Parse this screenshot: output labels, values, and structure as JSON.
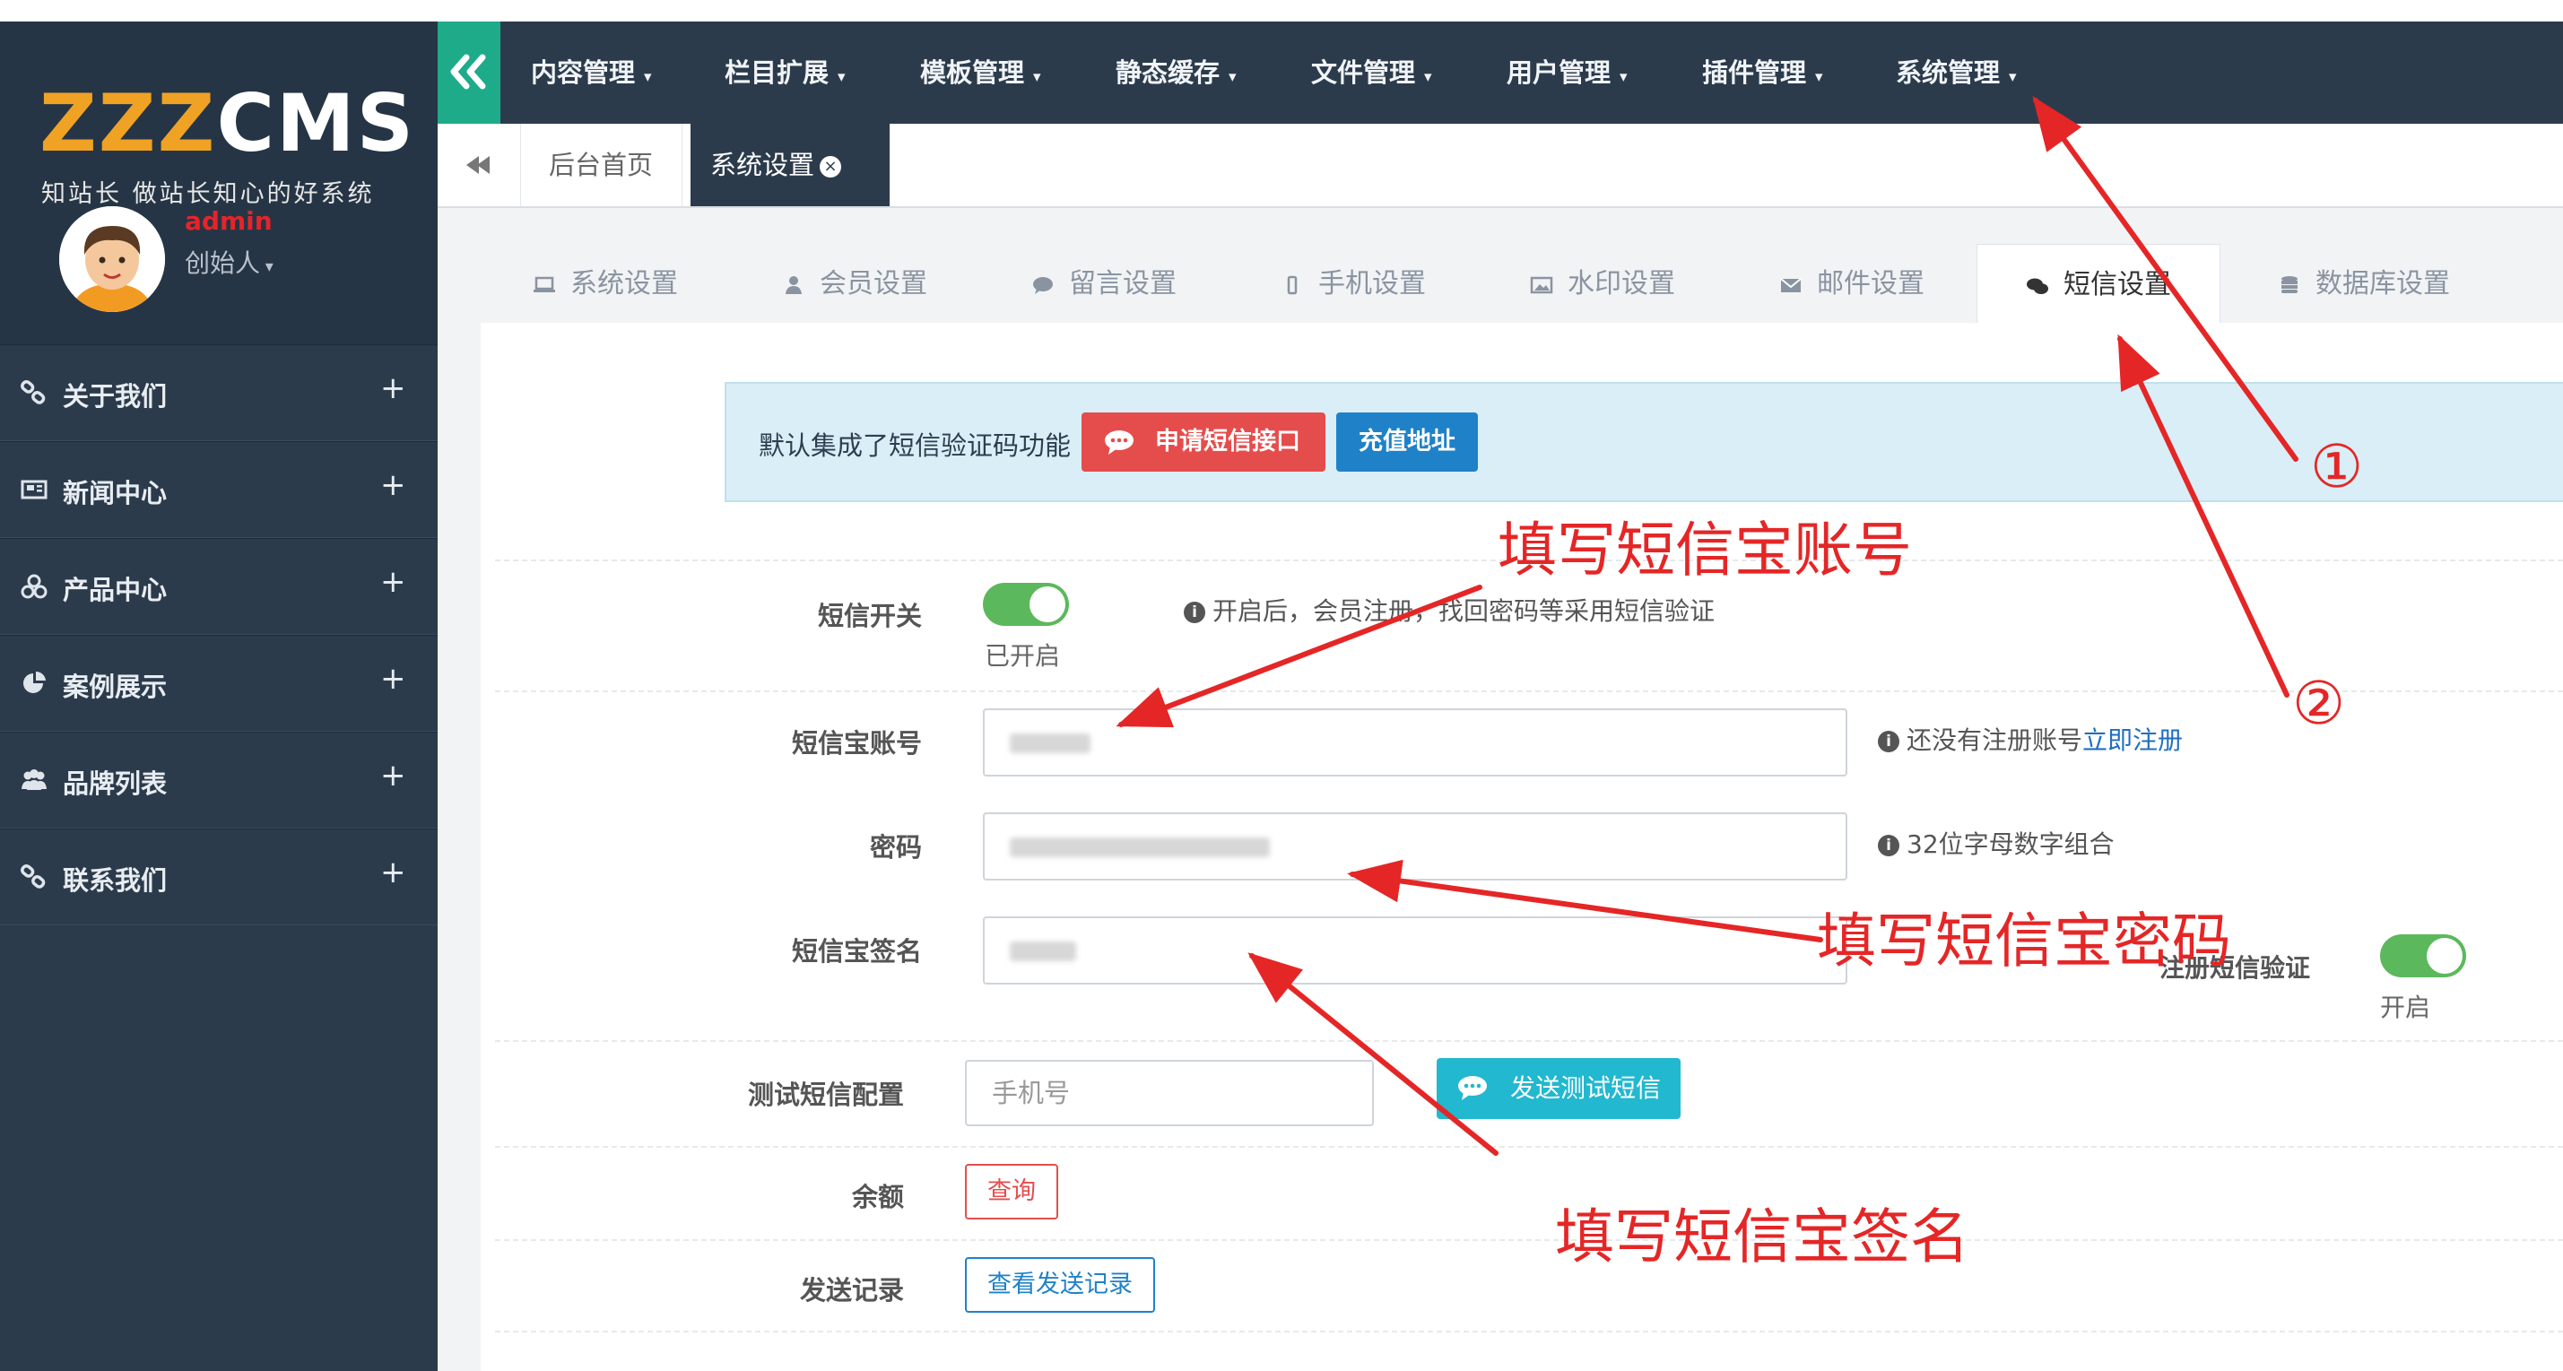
{
  "brand": {
    "logo_a": "ZZZ",
    "logo_b": "CMS",
    "slogan": "知站长 做站长知心的好系统"
  },
  "user": {
    "name": "admin",
    "role": "创始人"
  },
  "sidebar": {
    "items": [
      {
        "label": "关于我们",
        "icon": "link-icon"
      },
      {
        "label": "新闻中心",
        "icon": "newspaper-icon"
      },
      {
        "label": "产品中心",
        "icon": "cubes-icon"
      },
      {
        "label": "案例展示",
        "icon": "pie-chart-icon"
      },
      {
        "label": "品牌列表",
        "icon": "users-icon"
      },
      {
        "label": "联系我们",
        "icon": "link-icon"
      }
    ],
    "expand_symbol": "+"
  },
  "topnav": {
    "items": [
      {
        "label": "内容管理"
      },
      {
        "label": "栏目扩展"
      },
      {
        "label": "模板管理"
      },
      {
        "label": "静态缓存"
      },
      {
        "label": "文件管理"
      },
      {
        "label": "用户管理"
      },
      {
        "label": "插件管理"
      },
      {
        "label": "系统管理"
      }
    ]
  },
  "pagetabs": {
    "home": "后台首页",
    "active": "系统设置"
  },
  "settings_tabs": [
    {
      "label": "系统设置",
      "icon": "laptop-icon"
    },
    {
      "label": "会员设置",
      "icon": "user-icon"
    },
    {
      "label": "留言设置",
      "icon": "comment-icon"
    },
    {
      "label": "手机设置",
      "icon": "mobile-icon"
    },
    {
      "label": "水印设置",
      "icon": "image-icon"
    },
    {
      "label": "邮件设置",
      "icon": "envelope-icon"
    },
    {
      "label": "短信设置",
      "icon": "comments-icon"
    },
    {
      "label": "数据库设置",
      "icon": "database-icon"
    }
  ],
  "alert": {
    "text": "默认集成了短信验证码功能",
    "apply_button": "申请短信接口",
    "recharge_button": "充值地址"
  },
  "form": {
    "sms_switch": {
      "label": "短信开关",
      "state": "已开启",
      "help": "开启后，会员注册，找回密码等采用短信验证"
    },
    "account": {
      "label": "短信宝账号",
      "help_prefix": "还没有注册账号",
      "help_link": "立即注册"
    },
    "password": {
      "label": "密码",
      "help": "32位字母数字组合"
    },
    "signature": {
      "label": "短信宝签名"
    },
    "register_verify": {
      "label": "注册短信验证",
      "state": "开启"
    },
    "test": {
      "label": "测试短信配置",
      "placeholder": "手机号",
      "button": "发送测试短信"
    },
    "balance": {
      "label": "余额",
      "button": "查询"
    },
    "log": {
      "label": "发送记录",
      "button": "查看发送记录"
    }
  },
  "annotations": {
    "fill_account": "填写短信宝账号",
    "fill_password": "填写短信宝密码",
    "fill_signature": "填写短信宝签名",
    "step1": "①",
    "step2": "②"
  },
  "colors": {
    "sidebar": "#2c3b4c",
    "accent_green": "#1eab8a",
    "toggle_on": "#5cb85c",
    "danger": "#e54d4d",
    "primary": "#1f82c8",
    "info": "#22b8cf",
    "annotation": "#e52626"
  }
}
